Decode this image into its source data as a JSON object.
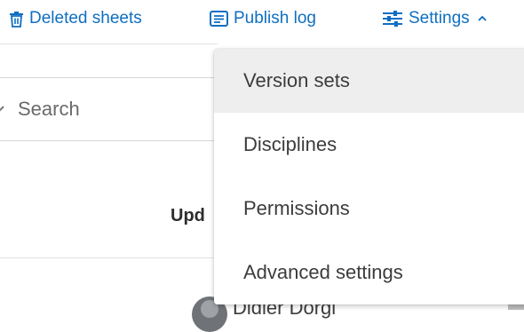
{
  "toolbar": {
    "deleted_sheets": {
      "label": "Deleted sheets",
      "icon": "trash-icon"
    },
    "publish_log": {
      "label": "Publish log",
      "icon": "log-icon"
    },
    "settings": {
      "label": "Settings",
      "icon": "sliders-icon",
      "expanded": true
    }
  },
  "search": {
    "placeholder": "Search",
    "value": ""
  },
  "table": {
    "header_partial": "Upd",
    "row_user_partial": "Didier Dorgi"
  },
  "settings_menu": {
    "items": [
      {
        "label": "Version sets",
        "hovered": true
      },
      {
        "label": "Disciplines",
        "hovered": false
      },
      {
        "label": "Permissions",
        "hovered": false
      },
      {
        "label": "Advanced settings",
        "hovered": false
      }
    ]
  },
  "colors": {
    "accent": "#0e6fc2",
    "text": "#3c3c3c",
    "hover_bg": "#eeeeee"
  }
}
